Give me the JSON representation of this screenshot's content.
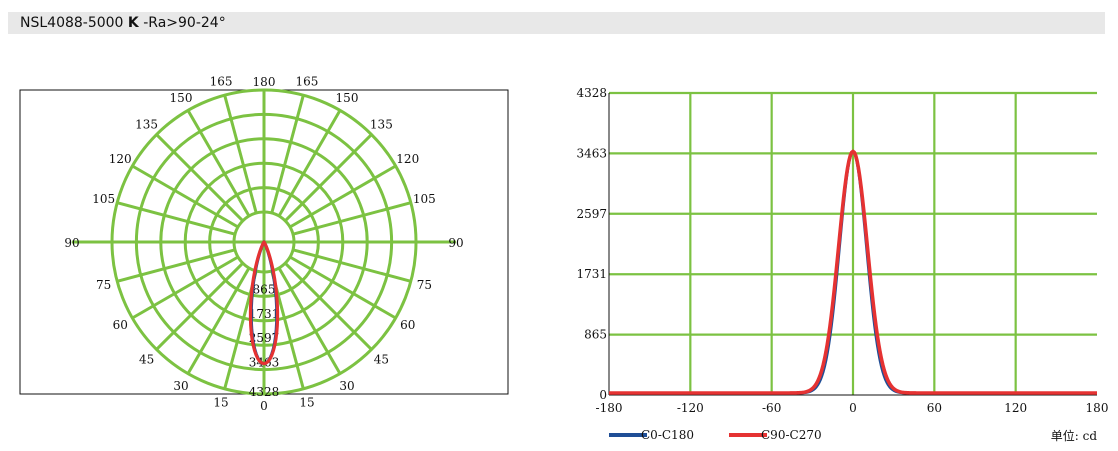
{
  "header": {
    "title_main": "NSL4088-5000",
    "title_bold": "K",
    "title_tail": "-Ra>90-24°"
  },
  "colors": {
    "grid": "#7cc242",
    "series_c0": "#1f4e96",
    "series_c90": "#e53232",
    "frame": "#111111"
  },
  "chart_data": [
    {
      "type": "polar",
      "angle_labels": [
        {
          "deg": 0,
          "label": "0"
        },
        {
          "deg": 15,
          "label": "15"
        },
        {
          "deg": 30,
          "label": "30"
        },
        {
          "deg": 45,
          "label": "45"
        },
        {
          "deg": 60,
          "label": "60"
        },
        {
          "deg": 75,
          "label": "75"
        },
        {
          "deg": 90,
          "label": "90"
        },
        {
          "deg": 105,
          "label": "105"
        },
        {
          "deg": 120,
          "label": "120"
        },
        {
          "deg": 135,
          "label": "135"
        },
        {
          "deg": 150,
          "label": "150"
        },
        {
          "deg": 165,
          "label": "165"
        },
        {
          "deg": 180,
          "label": "180"
        },
        {
          "deg": -15,
          "label": "15"
        },
        {
          "deg": -30,
          "label": "30"
        },
        {
          "deg": -45,
          "label": "45"
        },
        {
          "deg": -60,
          "label": "60"
        },
        {
          "deg": -75,
          "label": "75"
        },
        {
          "deg": -90,
          "label": "90"
        },
        {
          "deg": -105,
          "label": "105"
        },
        {
          "deg": -120,
          "label": "120"
        },
        {
          "deg": -135,
          "label": "135"
        },
        {
          "deg": -150,
          "label": "150"
        },
        {
          "deg": -165,
          "label": "165"
        }
      ],
      "radial_ticks": [
        865,
        1731,
        2597,
        3463,
        4328
      ],
      "radial_tick_labels": [
        "865",
        "1731",
        "2597",
        "3463",
        "4328"
      ],
      "rmax": 4328,
      "peak": 3463,
      "fwhm_deg": 24,
      "series": [
        {
          "key": "c0",
          "color_key": "series_c0",
          "sigma_deg": 10.0
        },
        {
          "key": "c90",
          "color_key": "series_c90",
          "sigma_deg": 10.6
        }
      ]
    },
    {
      "type": "line",
      "xlim": [
        -180,
        180
      ],
      "ylim": [
        0,
        4328
      ],
      "x_ticks": [
        -180,
        -120,
        -60,
        0,
        60,
        120,
        180
      ],
      "x_tick_labels": [
        "-180",
        "-120",
        "-60",
        "0",
        "60",
        "120",
        "180"
      ],
      "y_ticks": [
        0,
        865,
        1731,
        2597,
        3463,
        4328
      ],
      "y_tick_labels": [
        "0",
        "865",
        "1731",
        "2597",
        "3463",
        "4328"
      ],
      "series": [
        {
          "name": "C0-C180",
          "color_key": "series_c0",
          "peak": 3463,
          "sigma_deg": 10.0
        },
        {
          "name": "C90-C270",
          "color_key": "series_c90",
          "peak": 3463,
          "sigma_deg": 10.6
        }
      ],
      "unit_label": "单位: cd"
    }
  ]
}
